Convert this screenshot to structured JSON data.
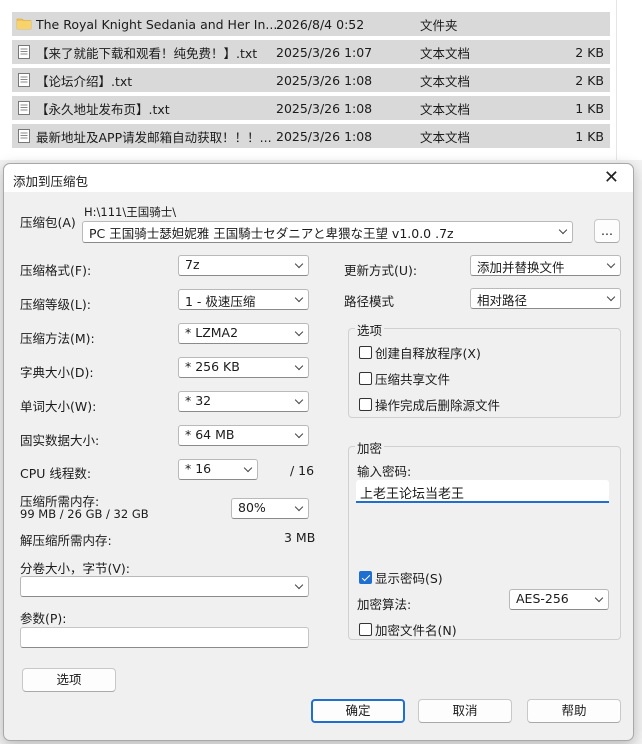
{
  "files": [
    {
      "icon": "folder-icon",
      "name": "The Royal Knight Sedania and Her In...",
      "date": "2026/8/4 0:52",
      "type": "文件夹",
      "size": ""
    },
    {
      "icon": "text-file-icon",
      "name": "【来了就能下载和观看！纯免费！】.txt",
      "date": "2025/3/26 1:07",
      "type": "文本文档",
      "size": "2 KB"
    },
    {
      "icon": "text-file-icon",
      "name": "【论坛介绍】.txt",
      "date": "2025/3/26 1:08",
      "type": "文本文档",
      "size": "2 KB"
    },
    {
      "icon": "text-file-icon",
      "name": "【永久地址发布页】.txt",
      "date": "2025/3/26 1:08",
      "type": "文本文档",
      "size": "1 KB"
    },
    {
      "icon": "text-file-icon",
      "name": "最新地址及APP请发邮箱自动获取！！！...",
      "date": "2025/3/26 1:08",
      "type": "文本文档",
      "size": "1 KB"
    }
  ],
  "dialog": {
    "title": "添加到压缩包",
    "close_glyph": "✕",
    "archive_label": "压缩包(A)",
    "archive_path": "H:\\111\\王国骑士\\",
    "archive_name": "PC 王国骑士瑟妲妮雅 王国騎士セダニアと卑猥な王望 v1.0.0 .7z",
    "browse_label": "...",
    "format_label": "压缩格式(F):",
    "format_value": "7z",
    "level_label": "压缩等级(L):",
    "level_value": "1 - 极速压缩",
    "method_label": "压缩方法(M):",
    "method_value": "*  LZMA2",
    "dict_label": "字典大小(D):",
    "dict_value": "*  256 KB",
    "word_label": "单词大小(W):",
    "word_value": "*  32",
    "solid_label": "固实数据大小:",
    "solid_value": "*  64 MB",
    "cpu_label": "CPU 线程数:",
    "cpu_value": "*  16",
    "cpu_total": "/ 16",
    "mem_label": "压缩所需内存:",
    "mem_detail": "99 MB / 26 GB / 32 GB",
    "mem_value": "80%",
    "decomp_label": "解压缩所需内存:",
    "decomp_value": "3 MB",
    "split_label": "分卷大小，字节(V):",
    "split_value": "",
    "params_label": "参数(P):",
    "params_value": "",
    "options_button": "选项",
    "update_label": "更新方式(U):",
    "update_value": "添加并替换文件",
    "pathmode_label": "路径模式",
    "pathmode_value": "相对路径",
    "options_group": "选项",
    "opt_sfx": "创建自释放程序(X)",
    "opt_shared": "压缩共享文件",
    "opt_delete": "操作完成后删除源文件",
    "encrypt_group": "加密",
    "pwd_label": "输入密码:",
    "pwd_value": "上老王论坛当老王",
    "show_pwd": "显示密码(S)",
    "method_enc_label": "加密算法:",
    "method_enc_value": "AES-256",
    "enc_names": "加密文件名(N)",
    "ok": "确定",
    "cancel": "取消",
    "help": "帮助"
  },
  "colors": {
    "accent": "#1f6fd1",
    "selected_row": "#d9d9d9",
    "dialog_bg": "#f0f0f0"
  }
}
